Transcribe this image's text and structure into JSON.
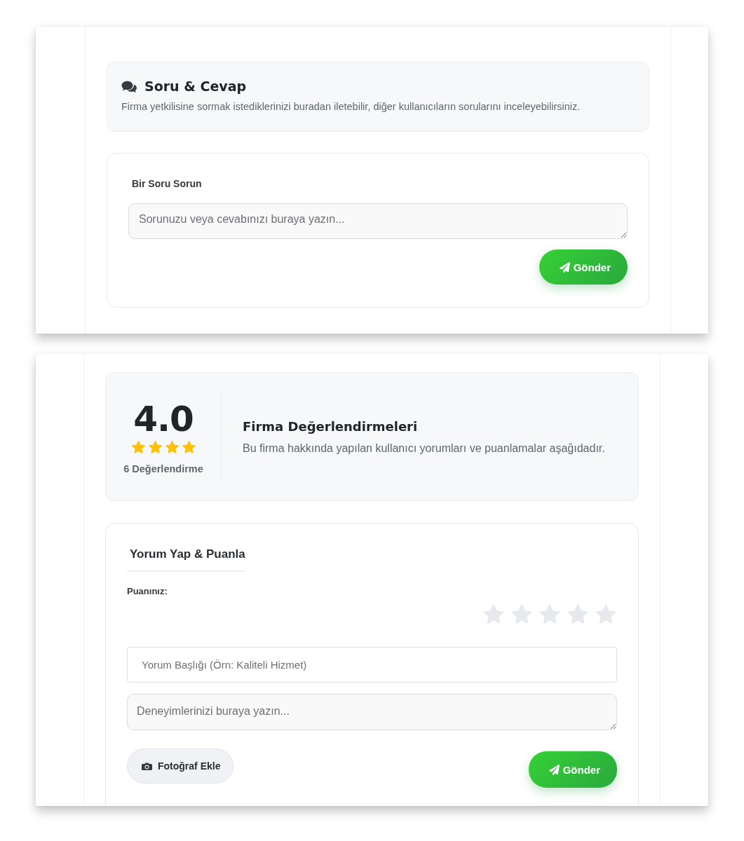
{
  "qa_panel": {
    "header": {
      "title": "Soru & Cevap",
      "description": "Firma yetkilisine sormak istediklerinizi buradan iletebilir, diğer kullanıcıların sorularını inceleyebilirsiniz."
    },
    "question_form": {
      "label": "Bir Soru Sorun",
      "textarea": {
        "placeholder": "Sorunuzu veya cevabınızı buraya yazın..."
      },
      "submit_button": "Gönder"
    }
  },
  "reviews_panel": {
    "summary": {
      "score": "4.0",
      "stars": 4,
      "count": "6 Değerlendirme",
      "title": "Firma Değerlendirmeleri",
      "description": "Bu firma hakkında yapılan kullanıcı yorumları ve puanlamalar aşağıdadır."
    },
    "review_form": {
      "title": "Yorum Yap & Puanla",
      "rating_label": "Puanınız:",
      "stars": 0,
      "title_input": {
        "placeholder": "Yorum Başlığı (Örn: Kaliteli Hizmet)"
      },
      "body_textarea": {
        "placeholder": "Deneyimlerinizi buraya yazın..."
      },
      "photo_button": "Fotoğraf Ekle",
      "submit_button": "Gönder"
    }
  }
}
